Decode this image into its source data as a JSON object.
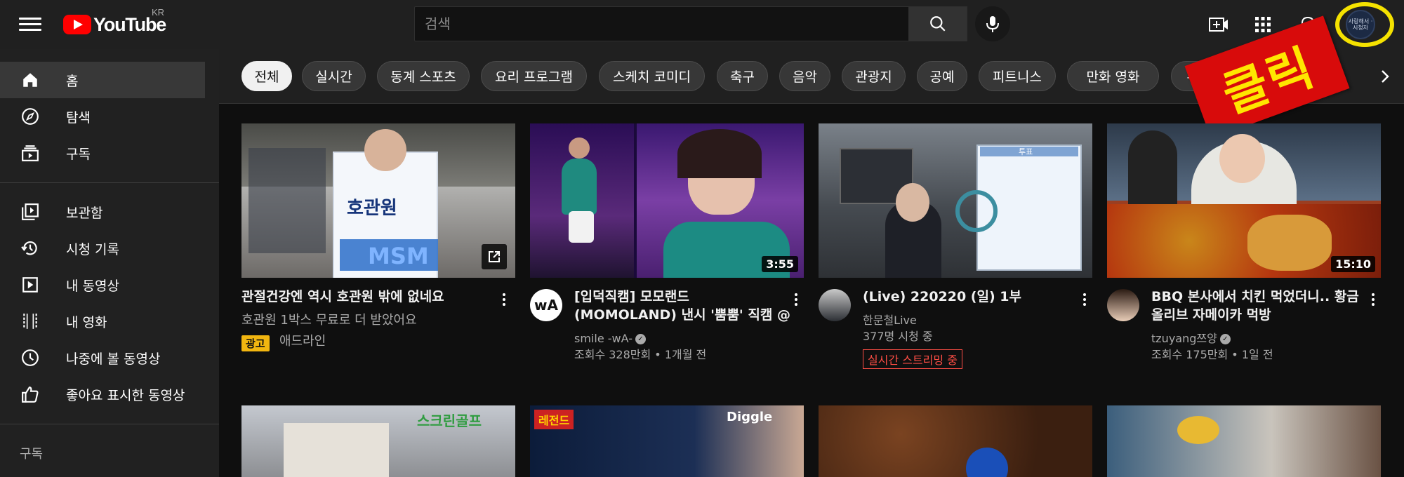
{
  "header": {
    "logo_text": "YouTube",
    "country": "KR",
    "search_placeholder": "검색",
    "avatar_text": "사랑해서 · 시청자"
  },
  "sidebar": {
    "items": [
      {
        "label": "홈",
        "icon": "home-icon",
        "active": true
      },
      {
        "label": "탐색",
        "icon": "explore-icon"
      },
      {
        "label": "구독",
        "icon": "subscriptions-icon"
      },
      {
        "label": "보관함",
        "icon": "library-icon"
      },
      {
        "label": "시청 기록",
        "icon": "history-icon"
      },
      {
        "label": "내 동영상",
        "icon": "your-videos-icon"
      },
      {
        "label": "내 영화",
        "icon": "your-movies-icon"
      },
      {
        "label": "나중에 볼 동영상",
        "icon": "watch-later-icon"
      },
      {
        "label": "좋아요 표시한 동영상",
        "icon": "liked-videos-icon"
      }
    ],
    "section_subscriptions": "구독"
  },
  "chips": [
    "전체",
    "실시간",
    "동계 스포츠",
    "요리 프로그램",
    "스케치 코미디",
    "축구",
    "음악",
    "관광지",
    "공예",
    "피트니스",
    "만화 영화",
    "수학"
  ],
  "overlay": {
    "click_label": "클릭",
    "highlight_color": "#f5e200",
    "banner_color": "#d80b0b"
  },
  "videos": [
    {
      "title": "관절건강엔 역시 호관원 밖에 없네요",
      "subtitle": "호관원 1박스 무료로 더 받았어요",
      "ad_label": "광고",
      "advertiser": "애드라인",
      "thumb_text": "호관원",
      "thumb_text2": "MSM"
    },
    {
      "title": "[입덕직캠] 모모랜드 (MOMOLAND) 낸시 '뿜뿜' 직캠 @ 논산 딸기 축제 |...",
      "channel": "smile -wA-",
      "meta": "조회수 328만회 • 1개월 전",
      "duration": "3:55",
      "avatar_text": "wA"
    },
    {
      "title": "(Live) 220220 (일) 1부",
      "channel": "한문철Live",
      "meta": "377명 시청 중",
      "live_label": "실시간 스트리밍 중",
      "thumb_text": "투표"
    },
    {
      "title": "BBQ 본사에서 치킨 먹었더니.. 황금올리브 자메이카 먹방",
      "channel": "tzuyang쯔양",
      "meta": "조회수 175만회 • 1일 전",
      "duration": "15:10"
    }
  ],
  "row2": [
    {
      "thumb_text": "스크린골프"
    },
    {
      "thumb_text": "Diggle",
      "thumb_tag": "레전드"
    },
    {},
    {}
  ]
}
